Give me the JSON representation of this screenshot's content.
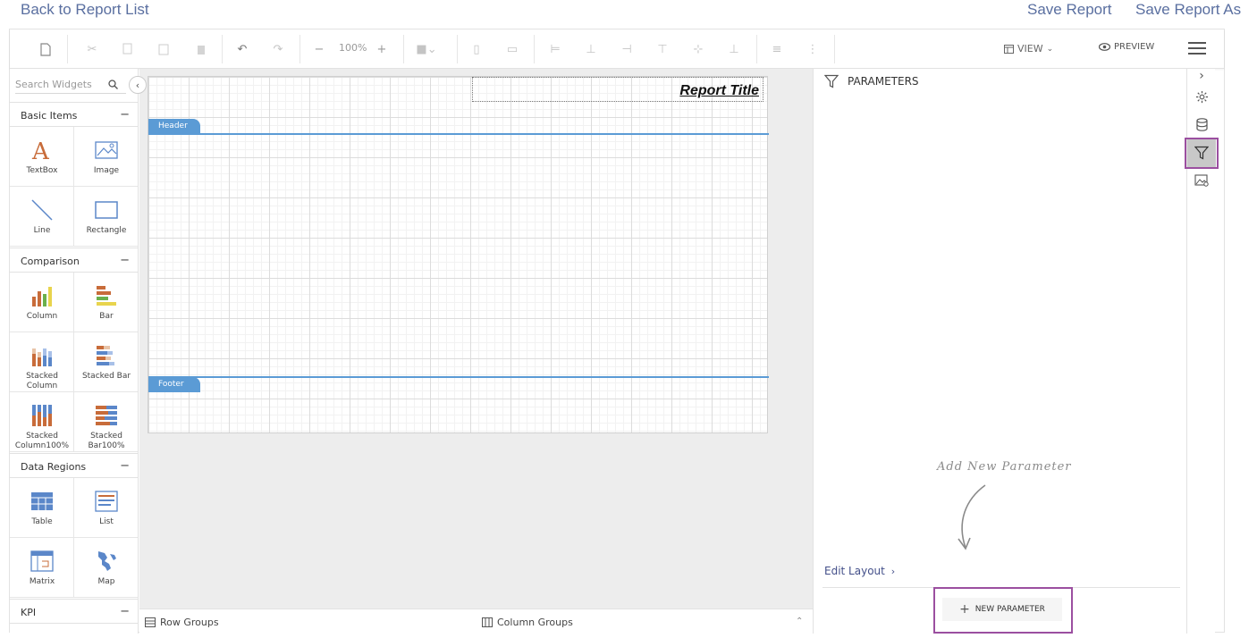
{
  "top": {
    "back_label": "Back to Report List",
    "save_label": "Save Report",
    "save_as_label": "Save Report As"
  },
  "toolbar": {
    "zoom": "100%",
    "view_label": "VIEW",
    "preview_label": "PREVIEW"
  },
  "widgets": {
    "search_placeholder": "Search Widgets",
    "sections": {
      "basic": "Basic Items",
      "comparison": "Comparison",
      "data_regions": "Data Regions",
      "kpi": "KPI"
    },
    "items": {
      "textbox": "TextBox",
      "image": "Image",
      "line": "Line",
      "rectangle": "Rectangle",
      "column": "Column",
      "bar": "Bar",
      "stacked_column": "Stacked Column",
      "stacked_bar": "Stacked Bar",
      "stacked_column100": "Stacked Column100%",
      "stacked_bar100": "Stacked Bar100%",
      "table": "Table",
      "list": "List",
      "matrix": "Matrix",
      "map": "Map"
    }
  },
  "report": {
    "title": "Report Title",
    "header_label": "Header",
    "footer_label": "Footer"
  },
  "groups": {
    "row_label": "Row Groups",
    "column_label": "Column Groups"
  },
  "parameters": {
    "heading": "PARAMETERS",
    "hint": "Add New Parameter",
    "edit_layout": "Edit Layout",
    "new_button": "NEW PARAMETER"
  },
  "colors": {
    "accent_purple": "#9b4fa0",
    "band_blue": "#5b9bd5",
    "link_blue": "#5a6fa0"
  }
}
